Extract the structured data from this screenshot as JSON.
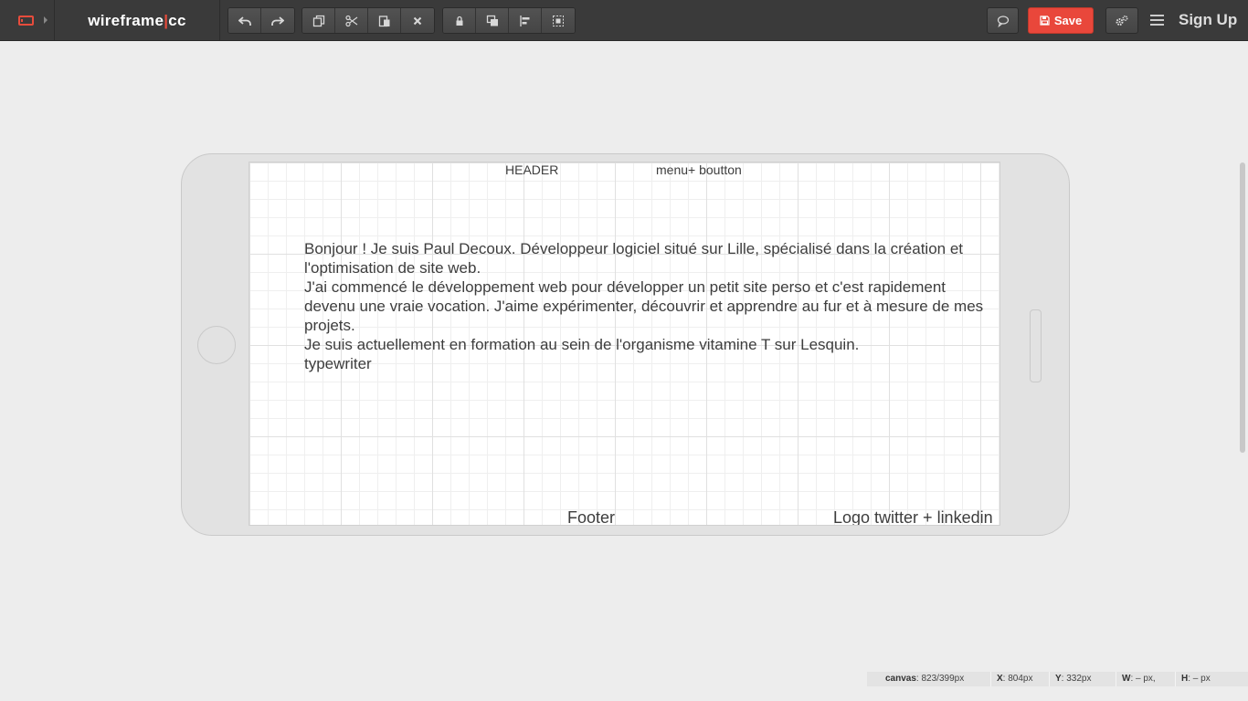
{
  "app": {
    "logo_left": "wireframe",
    "logo_sep": "|",
    "logo_right": "cc",
    "save_label": "Save",
    "signup_label": "Sign Up",
    "accent_color": "#e9473b"
  },
  "toolbar": {
    "history": [
      {
        "name": "undo-icon"
      },
      {
        "name": "redo-icon"
      }
    ],
    "edit": [
      {
        "name": "duplicate-icon"
      },
      {
        "name": "cut-icon"
      },
      {
        "name": "paste-icon"
      },
      {
        "name": "delete-icon"
      }
    ],
    "arrange": [
      {
        "name": "lock-icon"
      },
      {
        "name": "bring-to-front-icon"
      },
      {
        "name": "align-icon"
      },
      {
        "name": "group-icon"
      }
    ]
  },
  "wireframe": {
    "header": "HEADER",
    "menu": "menu+ boutton",
    "body_lines": [
      "Bonjour ! Je suis Paul Decoux. Développeur logiciel situé sur Lille, spécialisé dans la création et l'optimisation de site web.",
      "J'ai commencé le développement web pour développer un petit site perso et c'est rapidement devenu une vraie vocation. J'aime expérimenter, découvrir et apprendre au fur et à mesure de mes projets.",
      "Je suis actuellement en formation au sein de l'organisme vitamine T sur Lesquin.",
      "typewriter"
    ],
    "footer": "Footer",
    "social": "Logo twitter + linkedin"
  },
  "status": {
    "canvas_label": "canvas",
    "canvas_value": ": 823/399px",
    "x_label": "X",
    "x_value": ": 804px",
    "y_label": "Y",
    "y_value": ": 332px",
    "w_label": "W",
    "w_value": ": – px,",
    "h_label": "H",
    "h_value": ": – px"
  }
}
